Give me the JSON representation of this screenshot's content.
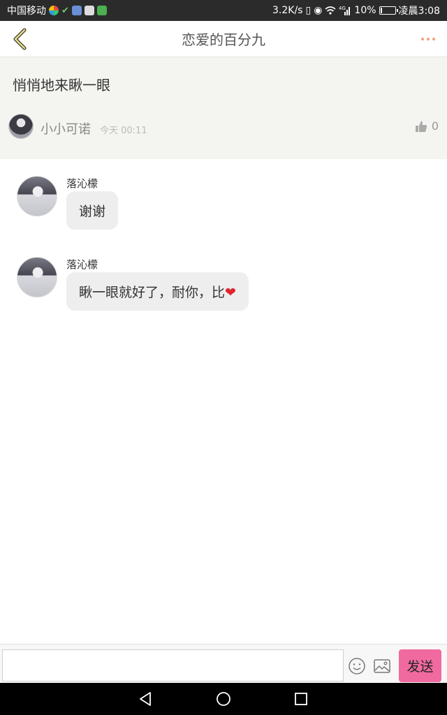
{
  "status_bar": {
    "carrier": "中国移动",
    "speed": "3.2K/s",
    "network_type": "4G",
    "battery": "10%",
    "time": "凌晨3:08"
  },
  "header": {
    "title": "恋爱的百分九"
  },
  "post": {
    "title": "悄悄地来瞅一眼",
    "author": "小小可诺",
    "time": "今天 00:11",
    "likes": "0"
  },
  "comments": [
    {
      "name": "落沁檬",
      "text": "谢谢"
    },
    {
      "name": "落沁檬",
      "text": "瞅一眼就好了，耐你，比",
      "emoji": "❤"
    }
  ],
  "input_bar": {
    "placeholder": "",
    "send_label": "发送"
  },
  "colors": {
    "accent_pink": "#f06aa0",
    "more_dots": "#f2a07a",
    "post_bg": "#f4f4f0",
    "bubble_bg": "#eeeeee",
    "heart": "#e0242c"
  },
  "icons": {
    "back": "back-chevron-icon",
    "more": "more-dots-icon",
    "like": "thumbs-up-icon",
    "emoji": "smiley-icon",
    "image": "image-icon",
    "nav_back": "triangle-back-icon",
    "nav_home": "circle-home-icon",
    "nav_recent": "square-recent-icon"
  }
}
